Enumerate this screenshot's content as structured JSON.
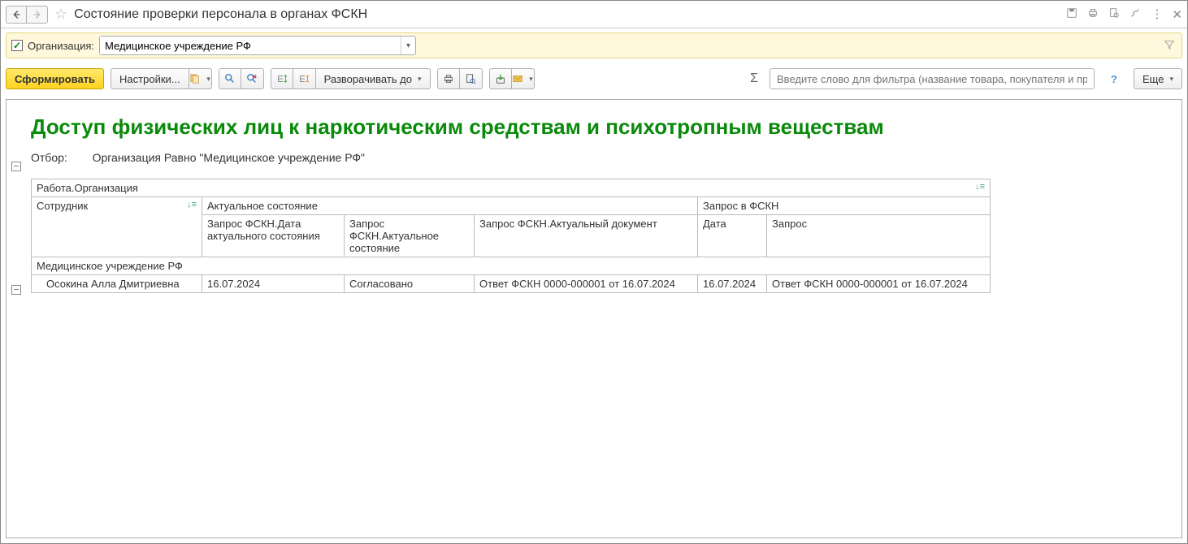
{
  "header": {
    "title": "Состояние проверки персонала в органах ФСКН"
  },
  "filter_panel": {
    "label": "Организация:",
    "value": "Медицинское учреждение РФ"
  },
  "toolbar": {
    "generate": "Сформировать",
    "settings": "Настройки...",
    "expand_to": "Разворачивать до",
    "more": "Еще",
    "filter_placeholder": "Введите слово для фильтра (название товара, покупателя и пр.)"
  },
  "report": {
    "title": "Доступ физических лиц к наркотическим средствам и психотропным веществам",
    "filter_label": "Отбор:",
    "filter_value": "Организация Равно \"Медицинское учреждение РФ\"",
    "headers": {
      "group": "Работа.Организация",
      "employee": "Сотрудник",
      "actual_state": "Актуальное состояние",
      "request_fskn": "Запрос в ФСКН",
      "sub_date_state": "Запрос ФСКН.Дата актуального состояния",
      "sub_actual": "Запрос ФСКН.Актуальное состояние",
      "sub_doc": "Запрос ФСКН.Актуальный документ",
      "sub_req_date": "Дата",
      "sub_req": "Запрос"
    },
    "group_row": "Медицинское учреждение РФ",
    "data_row": {
      "employee": "Осокина Алла Дмитриевна",
      "date_state": "16.07.2024",
      "actual": "Согласовано",
      "doc": "Ответ ФСКН 0000-000001 от 16.07.2024",
      "req_date": "16.07.2024",
      "req": "Ответ ФСКН 0000-000001 от 16.07.2024"
    }
  }
}
